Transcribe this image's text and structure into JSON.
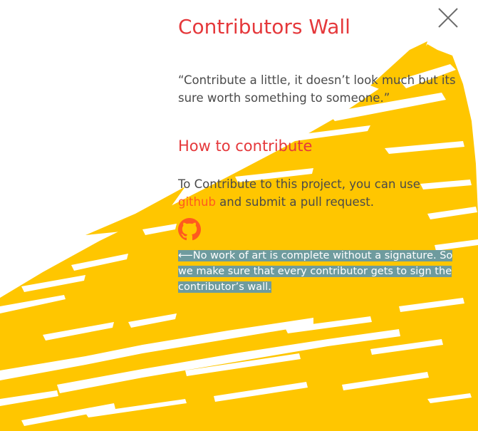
{
  "header": {
    "title": "Contributors Wall"
  },
  "quote": "“Contribute a little, it doesn’t look much but its sure worth something to someone.”",
  "how_to": {
    "title": "How to contribute",
    "text_before": "To Contribute to this project, you can use",
    "link_label": "github",
    "text_after": "and submit a pull request."
  },
  "note": {
    "arrow": "⟵",
    "text": "No work of art is complete without a signature. So we make sure that every contributor gets to sign the contributor’s wall."
  },
  "colors": {
    "accent": "#e5383b",
    "link": "#ff5a1f",
    "paint": "#ffc600",
    "highlight": "#6e9b9e",
    "body_text": "#4a4a4a"
  },
  "icons": {
    "close": "close-icon",
    "github": "github-icon"
  }
}
